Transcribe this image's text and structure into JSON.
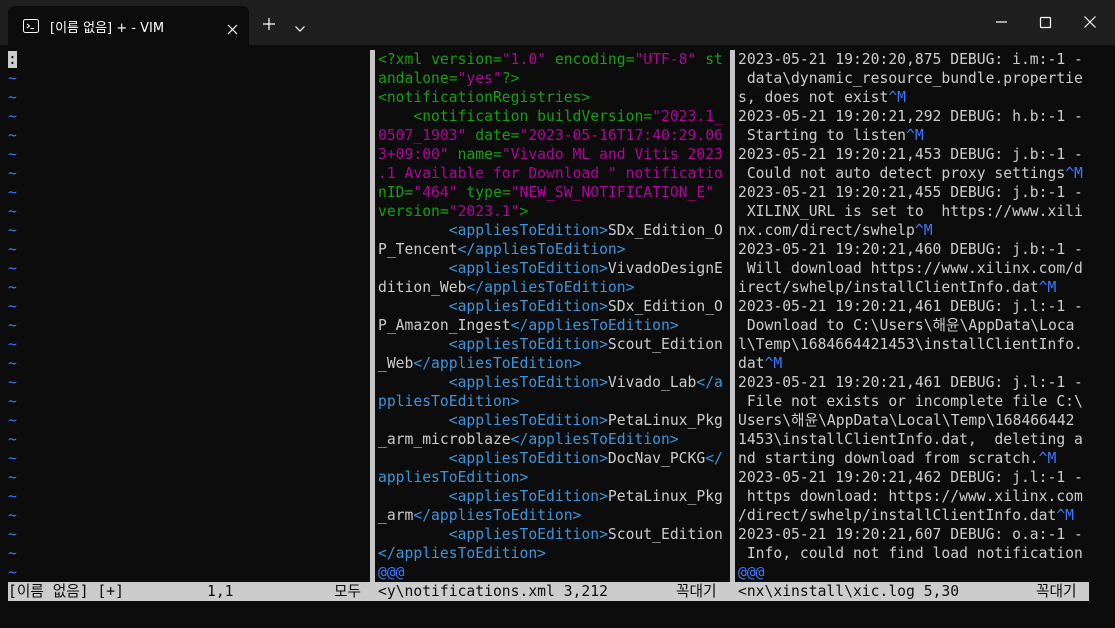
{
  "window": {
    "tab_title": "[이름 없음] + - VIM",
    "terminal_icon": "terminal-icon",
    "buttons": [
      "close-tab",
      "new-tab",
      "tab-dropdown",
      "minimize",
      "maximize",
      "close-window"
    ]
  },
  "colors": {
    "background": "#0c0c0c",
    "text": "#cccccc",
    "tilde": "#3b78ff",
    "xml_tag": "#13a10e",
    "xml_string": "#b4009e",
    "xml_applies_tag": "#3a96dd",
    "xml_applies_bracket": "#61d6d6",
    "special_key": "#3b78ff"
  },
  "panes": {
    "left": {
      "cursor_char": ":",
      "tilde_char": "~",
      "tilde_count": 27
    },
    "middle": {
      "lines": [
        [
          {
            "t": "<?xml ",
            "c": "g"
          },
          {
            "t": "version",
            "c": "g"
          },
          {
            "t": "=",
            "c": "g"
          },
          {
            "t": "\"1.0\"",
            "c": "m"
          },
          {
            "t": " encoding",
            "c": "g"
          },
          {
            "t": "=",
            "c": "g"
          },
          {
            "t": "\"UTF-8\"",
            "c": "m"
          },
          {
            "t": " st",
            "c": "g"
          }
        ],
        [
          {
            "t": "andalone",
            "c": "g"
          },
          {
            "t": "=",
            "c": "g"
          },
          {
            "t": "\"yes\"",
            "c": "m"
          },
          {
            "t": "?>",
            "c": "g"
          }
        ],
        [
          {
            "t": "<notificationRegistries>",
            "c": "g"
          }
        ],
        [
          {
            "t": "    <notification ",
            "c": "g"
          },
          {
            "t": "buildVersion",
            "c": "g"
          },
          {
            "t": "=",
            "c": "g"
          },
          {
            "t": "\"2023.1_",
            "c": "m"
          }
        ],
        [
          {
            "t": "0507_1903\"",
            "c": "m"
          },
          {
            "t": " date",
            "c": "g"
          },
          {
            "t": "=",
            "c": "g"
          },
          {
            "t": "\"2023-05-16T17:40:29.06",
            "c": "m"
          }
        ],
        [
          {
            "t": "3+09:00\"",
            "c": "m"
          },
          {
            "t": " name",
            "c": "g"
          },
          {
            "t": "=",
            "c": "g"
          },
          {
            "t": "\"Vivado ML and Vitis 2023",
            "c": "m"
          }
        ],
        [
          {
            "t": ".1 Available for Download \" notificatio",
            "c": "m"
          }
        ],
        [
          {
            "t": "nID",
            "c": "g"
          },
          {
            "t": "=",
            "c": "g"
          },
          {
            "t": "\"464\"",
            "c": "m"
          },
          {
            "t": " type",
            "c": "g"
          },
          {
            "t": "=",
            "c": "g"
          },
          {
            "t": "\"NEW_SW_NOTIFICATION_E\"",
            "c": "m"
          }
        ],
        [
          {
            "t": "version",
            "c": "g"
          },
          {
            "t": "=",
            "c": "g"
          },
          {
            "t": "\"2023.1\"",
            "c": "m"
          },
          {
            "t": ">",
            "c": "g"
          }
        ],
        [
          {
            "t": "        ",
            "c": ""
          },
          {
            "t": "<appliesToEdition>",
            "c": "a"
          },
          {
            "t": "SDx_Edition_O",
            "c": ""
          }
        ],
        [
          {
            "t": "P_Tencent",
            "c": ""
          },
          {
            "t": "</appliesToEdition>",
            "c": "a"
          }
        ],
        [
          {
            "t": "        ",
            "c": ""
          },
          {
            "t": "<appliesToEdition>",
            "c": "a"
          },
          {
            "t": "VivadoDesignE",
            "c": ""
          }
        ],
        [
          {
            "t": "dition_Web",
            "c": ""
          },
          {
            "t": "</appliesToEdition>",
            "c": "a"
          }
        ],
        [
          {
            "t": "        ",
            "c": ""
          },
          {
            "t": "<appliesToEdition>",
            "c": "a"
          },
          {
            "t": "SDx_Edition_O",
            "c": ""
          }
        ],
        [
          {
            "t": "P_Amazon_Ingest",
            "c": ""
          },
          {
            "t": "</appliesToEdition>",
            "c": "a"
          }
        ],
        [
          {
            "t": "        ",
            "c": ""
          },
          {
            "t": "<appliesToEdition>",
            "c": "a"
          },
          {
            "t": "Scout_Edition",
            "c": ""
          }
        ],
        [
          {
            "t": "_Web",
            "c": ""
          },
          {
            "t": "</appliesToEdition>",
            "c": "a"
          }
        ],
        [
          {
            "t": "        ",
            "c": ""
          },
          {
            "t": "<appliesToEdition>",
            "c": "a"
          },
          {
            "t": "Vivado_Lab",
            "c": ""
          },
          {
            "t": "</a",
            "c": "a"
          }
        ],
        [
          {
            "t": "ppliesToEdition>",
            "c": "a"
          }
        ],
        [
          {
            "t": "        ",
            "c": ""
          },
          {
            "t": "<appliesToEdition>",
            "c": "a"
          },
          {
            "t": "PetaLinux_Pkg",
            "c": ""
          }
        ],
        [
          {
            "t": "_arm_microblaze",
            "c": ""
          },
          {
            "t": "</appliesToEdition>",
            "c": "a"
          }
        ],
        [
          {
            "t": "        ",
            "c": ""
          },
          {
            "t": "<appliesToEdition>",
            "c": "a"
          },
          {
            "t": "DocNav_PCKG",
            "c": ""
          },
          {
            "t": "</",
            "c": "a"
          }
        ],
        [
          {
            "t": "appliesToEdition>",
            "c": "a"
          }
        ],
        [
          {
            "t": "        ",
            "c": ""
          },
          {
            "t": "<appliesToEdition>",
            "c": "a"
          },
          {
            "t": "PetaLinux_Pkg",
            "c": ""
          }
        ],
        [
          {
            "t": "_arm",
            "c": ""
          },
          {
            "t": "</appliesToEdition>",
            "c": "a"
          }
        ],
        [
          {
            "t": "        ",
            "c": ""
          },
          {
            "t": "<appliesToEdition>",
            "c": "a"
          },
          {
            "t": "Scout_Edition",
            "c": ""
          }
        ],
        [
          {
            "t": "</appliesToEdition>",
            "c": "a"
          }
        ],
        [
          {
            "t": "@@@",
            "c": "b"
          }
        ]
      ]
    },
    "right": {
      "lines": [
        [
          {
            "t": "2023-05-21 19:20:20,875 DEBUG: i.m:-1 -",
            "c": ""
          }
        ],
        [
          {
            "t": " data\\dynamic_resource_bundle.propertie",
            "c": ""
          }
        ],
        [
          {
            "t": "s, does not exist",
            "c": ""
          },
          {
            "t": "^M",
            "c": "b"
          }
        ],
        [
          {
            "t": "2023-05-21 19:20:21,292 DEBUG: h.b:-1 -",
            "c": ""
          }
        ],
        [
          {
            "t": " Starting to listen",
            "c": ""
          },
          {
            "t": "^M",
            "c": "b"
          }
        ],
        [
          {
            "t": "2023-05-21 19:20:21,453 DEBUG: j.b:-1 -",
            "c": ""
          }
        ],
        [
          {
            "t": " Could not auto detect proxy settings",
            "c": ""
          },
          {
            "t": "^M",
            "c": "b"
          }
        ],
        [
          {
            "t": "2023-05-21 19:20:21,455 DEBUG: j.b:-1 -",
            "c": ""
          }
        ],
        [
          {
            "t": " XILINX_URL is set to  https://www.xili",
            "c": ""
          }
        ],
        [
          {
            "t": "nx.com/direct/swhelp",
            "c": ""
          },
          {
            "t": "^M",
            "c": "b"
          }
        ],
        [
          {
            "t": "2023-05-21 19:20:21,460 DEBUG: j.b:-1 -",
            "c": ""
          }
        ],
        [
          {
            "t": " Will download https://www.xilinx.com/d",
            "c": ""
          }
        ],
        [
          {
            "t": "irect/swhelp/installClientInfo.dat",
            "c": ""
          },
          {
            "t": "^M",
            "c": "b"
          }
        ],
        [
          {
            "t": "2023-05-21 19:20:21,461 DEBUG: j.l:-1 -",
            "c": ""
          }
        ],
        [
          {
            "t": " Download to C:\\Users\\해윤\\AppData\\Loca",
            "c": ""
          }
        ],
        [
          {
            "t": "l\\Temp\\1684664421453\\installClientInfo.",
            "c": ""
          }
        ],
        [
          {
            "t": "dat",
            "c": ""
          },
          {
            "t": "^M",
            "c": "b"
          }
        ],
        [
          {
            "t": "2023-05-21 19:20:21,461 DEBUG: j.l:-1 -",
            "c": ""
          }
        ],
        [
          {
            "t": " File not exists or incomplete file C:\\",
            "c": ""
          }
        ],
        [
          {
            "t": "Users\\해윤\\AppData\\Local\\Temp\\168466442",
            "c": ""
          }
        ],
        [
          {
            "t": "1453\\installClientInfo.dat,  deleting a",
            "c": ""
          }
        ],
        [
          {
            "t": "nd starting download from scratch.",
            "c": ""
          },
          {
            "t": "^M",
            "c": "b"
          }
        ],
        [
          {
            "t": "2023-05-21 19:20:21,462 DEBUG: j.l:-1 -",
            "c": ""
          }
        ],
        [
          {
            "t": " https download: https://www.xilinx.com",
            "c": ""
          }
        ],
        [
          {
            "t": "/direct/swhelp/installClientInfo.dat",
            "c": ""
          },
          {
            "t": "^M",
            "c": "b"
          }
        ],
        [
          {
            "t": "2023-05-21 19:20:21,607 DEBUG: o.a:-1 -",
            "c": ""
          }
        ],
        [
          {
            "t": " Info, could not find load notification",
            "c": ""
          }
        ],
        [
          {
            "t": "@@@",
            "c": "b"
          }
        ]
      ]
    }
  },
  "statusline": {
    "left_name": "[이름 없음] [+]",
    "left_pos": "1,1",
    "left_pct": "모두",
    "mid_name": "<y\\notifications.xml 3,212",
    "mid_pct": "꼭대기",
    "right_name": "<nx\\xinstall\\xic.log 5,30",
    "right_pct": "꼭대기"
  }
}
